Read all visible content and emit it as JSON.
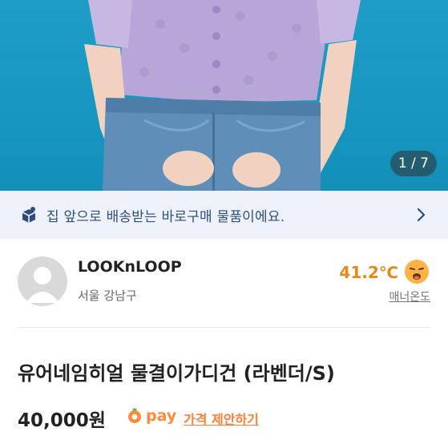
{
  "hero": {
    "counter": "1 / 7",
    "image": "lavender-cardigan-model-photo"
  },
  "banner": {
    "text": "집 앞으로 배송받는 바로구매 물품이에요.",
    "icon": "delivery-box-icon",
    "chevron": "chevron-right-icon"
  },
  "seller": {
    "name": "LOOKnLOOP",
    "location": "서울 강남구",
    "temperature": "41.2℃",
    "manner_label": "매너온도",
    "face_icon": "smile-face-icon"
  },
  "product": {
    "title": "유어네임히얼 물결이가디건 (라벤더/S)",
    "price": "40,000원",
    "pay_label": "pay",
    "offer_label": "가격 제안하기"
  },
  "colors": {
    "accent": "#ff7e36",
    "temp": "#e58a17",
    "banner_bg": "#eef3fb",
    "banner_text": "#2e4c7e",
    "hero_bg": "#1797c0"
  }
}
